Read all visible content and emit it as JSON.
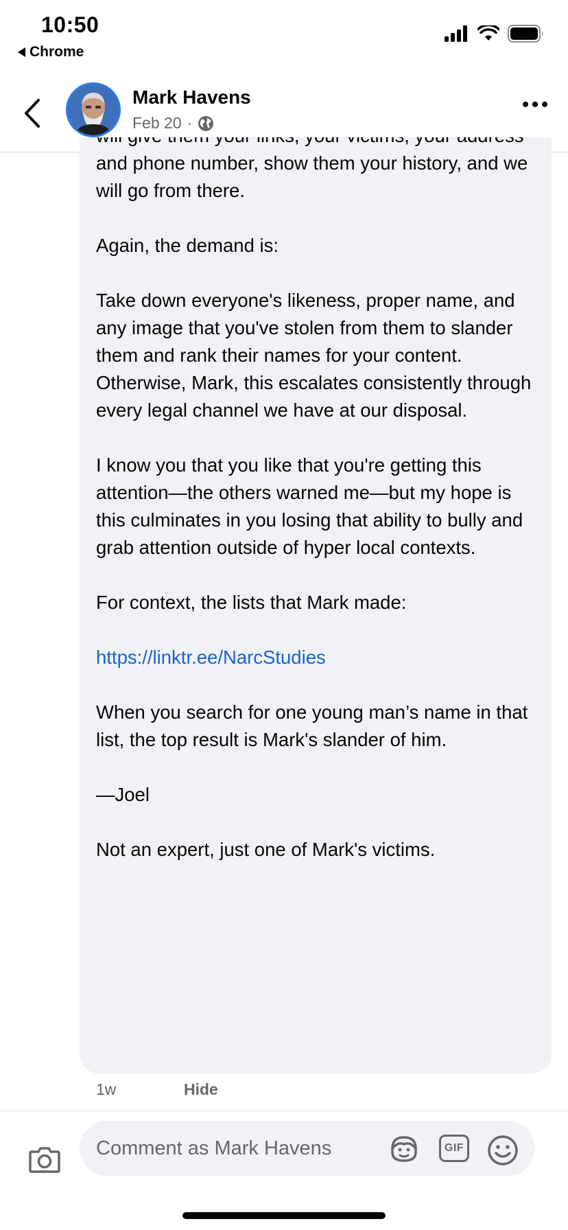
{
  "status_bar": {
    "time": "10:50",
    "back_app": "Chrome",
    "icons": [
      "signal-icon",
      "wifi-icon",
      "battery-icon"
    ]
  },
  "header": {
    "author_name": "Mark Havens",
    "post_date": "Feb 20",
    "separator": "·",
    "audience_icon": "globe-icon"
  },
  "comment": {
    "paragraphs": [
      "harassment in Dallas. I'll see what they say. And, again, no hiding tracks—Nothing hidden here, man. I will give them your links, your victims, your address and phone number, show them your history, and we will go from there.",
      "Again, the demand is:",
      "Take down everyone's likeness, proper name, and any image that you've stolen from them to slander them and rank their names for your content. Otherwise, Mark, this escalates consistently through every legal channel we have at our disposal.",
      "I know you that you like that you're getting this attention—the others warned me—but my hope is this culminates in you losing that ability to bully and grab attention outside of hyper local contexts.",
      "For context, the lists that Mark made:",
      "https://linktr.ee/NarcStudies",
      "When you search for one young man’s name in that list, the top result is Mark's slander of him.",
      "—Joel",
      "Not an expert, just one of Mark's victims."
    ],
    "age": "1w",
    "hide_label": "Hide"
  },
  "composer": {
    "placeholder": "Comment as Mark Havens",
    "gif_label": "GIF",
    "icons": [
      "camera-icon",
      "avatar-sticker-icon",
      "gif-icon",
      "emoji-icon"
    ]
  },
  "colors": {
    "link": "#1b64c8",
    "bubble_bg": "#f0f2f5",
    "secondary_text": "#65676b",
    "avatar_ring": "#2d7be6"
  }
}
